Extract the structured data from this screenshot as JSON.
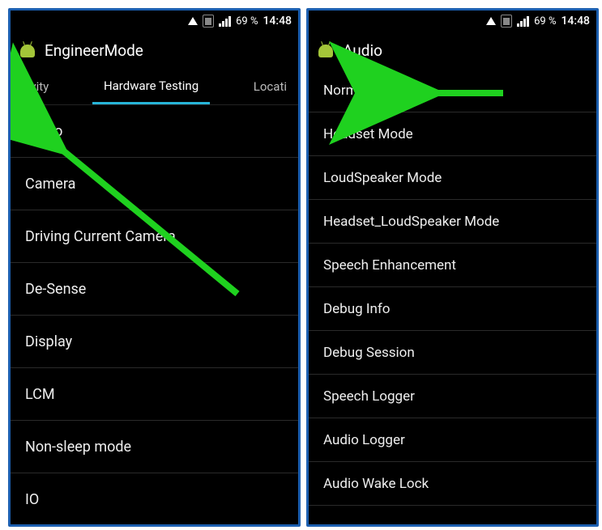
{
  "status": {
    "battery": "69 %",
    "time": "14:48"
  },
  "left": {
    "title": "EngineerMode",
    "tabs": {
      "prev": "ectivity",
      "active": "Hardware Testing",
      "next": "Locati"
    },
    "items": [
      "Audio",
      "Camera",
      "Driving Current Camera",
      "De-Sense",
      "Display",
      "LCM",
      "Non-sleep mode",
      "IO"
    ]
  },
  "right": {
    "title": "Audio",
    "items": [
      "Normal Mode",
      "Headset Mode",
      "LoudSpeaker Mode",
      "Headset_LoudSpeaker Mode",
      "Speech Enhancement",
      "Debug Info",
      "Debug Session",
      "Speech Logger",
      "Audio Logger",
      "Audio Wake Lock"
    ]
  }
}
